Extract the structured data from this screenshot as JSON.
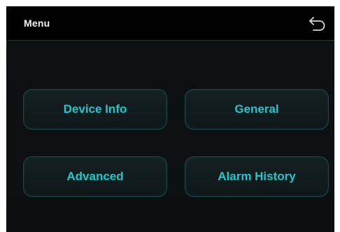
{
  "header": {
    "title": "Menu",
    "back_icon": "back-arrow-icon"
  },
  "menu": {
    "buttons": [
      {
        "label": "Device Info"
      },
      {
        "label": "General"
      },
      {
        "label": "Advanced"
      },
      {
        "label": "Alarm History"
      }
    ]
  },
  "colors": {
    "background": "#0a0d0e",
    "header_background": "#000000",
    "button_text": "#1fc8cc",
    "button_border": "#1e4a4c",
    "title_text": "#f2f2f2"
  }
}
